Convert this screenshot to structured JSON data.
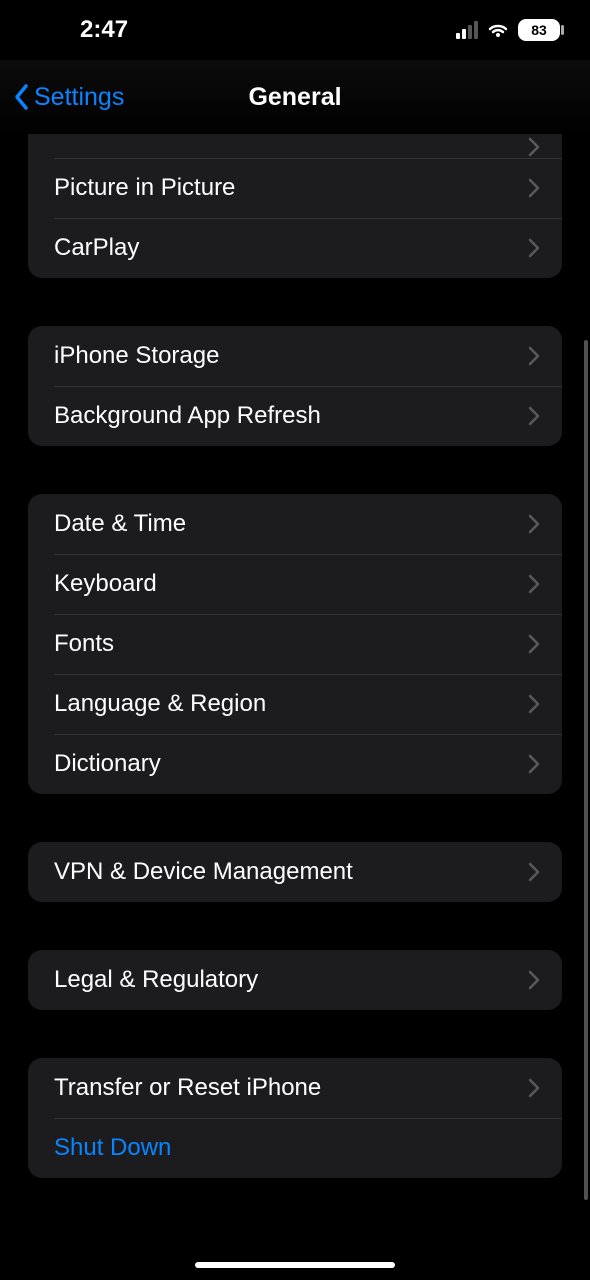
{
  "status": {
    "time": "2:47",
    "battery_pct": "83"
  },
  "nav": {
    "back_label": "Settings",
    "title": "General"
  },
  "group_cutoff": {
    "items": [
      {
        "label": ""
      },
      {
        "label": "Picture in Picture"
      },
      {
        "label": "CarPlay"
      }
    ]
  },
  "group_storage": {
    "items": [
      {
        "label": "iPhone Storage"
      },
      {
        "label": "Background App Refresh"
      }
    ]
  },
  "group_dt": {
    "items": [
      {
        "label": "Date & Time"
      },
      {
        "label": "Keyboard"
      },
      {
        "label": "Fonts"
      },
      {
        "label": "Language & Region"
      },
      {
        "label": "Dictionary"
      }
    ]
  },
  "group_vpn": {
    "items": [
      {
        "label": "VPN & Device Management"
      }
    ]
  },
  "group_legal": {
    "items": [
      {
        "label": "Legal & Regulatory"
      }
    ]
  },
  "group_reset": {
    "items": [
      {
        "label": "Transfer or Reset iPhone",
        "link": false
      },
      {
        "label": "Shut Down",
        "link": true
      }
    ]
  }
}
